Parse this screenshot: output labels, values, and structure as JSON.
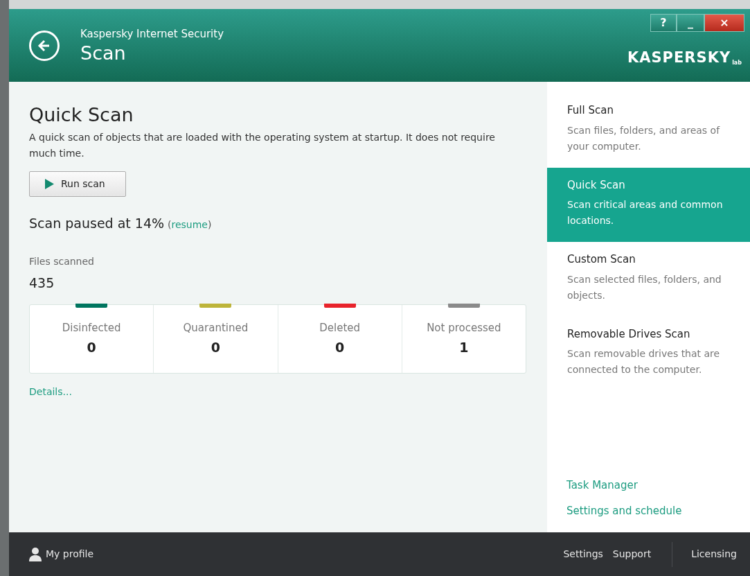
{
  "window": {
    "app_name": "Kaspersky Internet Security",
    "title": "Scan",
    "logo": "KASPERSKY",
    "logo_suffix": "lab",
    "controls": [
      "?",
      "_",
      "×"
    ]
  },
  "main": {
    "heading": "Quick Scan",
    "description": "A quick scan of objects that are loaded with the operating system at startup. It does not require much time.",
    "run_button": "Run scan",
    "status": "Scan paused at 14%",
    "resume_open": "(",
    "resume_link": "resume",
    "resume_close": ")",
    "files_label": "Files scanned",
    "files_count": "435",
    "stats": [
      {
        "label": "Disinfected",
        "value": "0",
        "color": "#00755f"
      },
      {
        "label": "Quarantined",
        "value": "0",
        "color": "#bdb43a"
      },
      {
        "label": "Deleted",
        "value": "0",
        "color": "#e8232b"
      },
      {
        "label": "Not processed",
        "value": "1",
        "color": "#8a8a8a"
      }
    ],
    "details_link": "Details..."
  },
  "sidebar": {
    "items": [
      {
        "title": "Full Scan",
        "description": "Scan files, folders, and areas of your computer.",
        "selected": false
      },
      {
        "title": "Quick Scan",
        "description": "Scan critical areas and common locations.",
        "selected": true
      },
      {
        "title": "Custom Scan",
        "description": "Scan selected files, folders, and objects.",
        "selected": false
      },
      {
        "title": "Removable Drives Scan",
        "description": "Scan removable drives that are connected to the computer.",
        "selected": false
      }
    ],
    "links": [
      "Task Manager",
      "Settings and schedule"
    ]
  },
  "status_bar": {
    "profile": "My profile",
    "links": [
      "Settings",
      "Support"
    ],
    "licensing": "Licensing"
  }
}
